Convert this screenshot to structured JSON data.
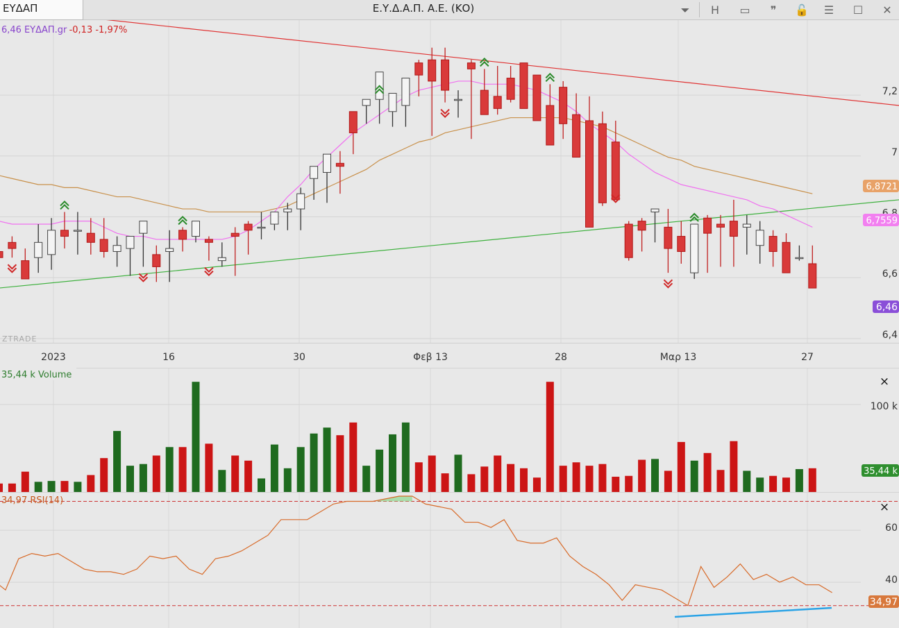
{
  "window": {
    "tab_label": "ΕΥΔΑΠ",
    "title": "Ε.Υ.Δ.Α.Π. Α.Ε. (ΚΟ)",
    "buttons": [
      {
        "name": "dropdown-button",
        "icon": "chevron-down-icon",
        "glyph": "⏷"
      },
      {
        "name": "h-button",
        "icon": "h-letter-icon",
        "glyph": "H"
      },
      {
        "name": "panel-button",
        "icon": "panel-icon",
        "glyph": "▭"
      },
      {
        "name": "quote-button",
        "icon": "quote-icon",
        "glyph": "❞"
      },
      {
        "name": "lock-button",
        "icon": "lock-icon",
        "glyph": "🔓"
      },
      {
        "name": "menu-button",
        "icon": "hamburger-icon",
        "glyph": "☰"
      },
      {
        "name": "maximize-button",
        "icon": "maximize-icon",
        "glyph": "☐"
      },
      {
        "name": "close-button",
        "icon": "close-icon",
        "glyph": "✕"
      }
    ]
  },
  "price_panel": {
    "legend_value": "6,46",
    "legend_name": "ΕΥΔΑΠ.gr",
    "legend_change": "-0,13 -1,97%",
    "watermark": "ZTRADE",
    "y_ticks": [
      "7,2",
      "7",
      "6,8",
      "6,6",
      "6,4"
    ],
    "badges": {
      "ma_slow": "6,8721",
      "ma_fast": "6,7559",
      "last": "6,46"
    }
  },
  "date_axis": [
    "2023",
    "16",
    "30",
    "Φεβ 13",
    "28",
    "Μαρ 13",
    "27"
  ],
  "volume_panel": {
    "legend": "35,44 k Volume",
    "tick": "100 k",
    "badge": "35,44 k",
    "close_glyph": "×"
  },
  "rsi_panel": {
    "legend": "34,97 RSI(14)",
    "ticks": [
      "60",
      "40"
    ],
    "badge": "34,97",
    "close_glyph": "×"
  },
  "colors": {
    "up": "#2a7d2a",
    "down": "#cc1515",
    "candle_down": "#d93a3a",
    "ma_fast": "#f070f0",
    "ma_slow": "#c8904a",
    "rsi": "#d86a28",
    "trend_red": "#e03030",
    "trend_green": "#3cb03c",
    "trend_blue": "#2aa3e6",
    "legend_purple": "#8844cc",
    "badge_last": "#8a4fd8"
  },
  "chart_data": [
    {
      "type": "candlestick",
      "title": "",
      "ylim": [
        6.37,
        7.41
      ],
      "dates": [
        "2022-12-28",
        "2022-12-29",
        "2022-12-30",
        "2023-01-02",
        "2023-01-03",
        "2023-01-04",
        "2023-01-05",
        "2023-01-09",
        "2023-01-10",
        "2023-01-11",
        "2023-01-12",
        "2023-01-13",
        "2023-01-16",
        "2023-01-17",
        "2023-01-18",
        "2023-01-19",
        "2023-01-20",
        "2023-01-23",
        "2023-01-24",
        "2023-01-25",
        "2023-01-26",
        "2023-01-27",
        "2023-01-30",
        "2023-01-31",
        "2023-02-01",
        "2023-02-02",
        "2023-02-03",
        "2023-02-06",
        "2023-02-07",
        "2023-02-08",
        "2023-02-09",
        "2023-02-10",
        "2023-02-13",
        "2023-02-14",
        "2023-02-15",
        "2023-02-16",
        "2023-02-17",
        "2023-02-20",
        "2023-02-21",
        "2023-02-22",
        "2023-02-23",
        "2023-02-24",
        "2023-02-28",
        "2023-03-01",
        "2023-03-02",
        "2023-03-03",
        "2023-03-06",
        "2023-03-07",
        "2023-03-08",
        "2023-03-09",
        "2023-03-10",
        "2023-03-13",
        "2023-03-14",
        "2023-03-15",
        "2023-03-16",
        "2023-03-17",
        "2023-03-20",
        "2023-03-21",
        "2023-03-22",
        "2023-03-23",
        "2023-03-24",
        "2023-03-27",
        "2023-03-28"
      ],
      "open": [
        6.67,
        6.7,
        6.64,
        6.65,
        6.66,
        6.74,
        6.74,
        6.73,
        6.71,
        6.67,
        6.68,
        6.73,
        6.66,
        6.67,
        6.74,
        6.72,
        6.71,
        6.64,
        6.73,
        6.76,
        6.75,
        6.76,
        6.8,
        6.81,
        6.91,
        6.93,
        6.96,
        7.13,
        7.15,
        7.17,
        7.13,
        7.15,
        7.29,
        7.3,
        7.3,
        7.17,
        7.29,
        7.2,
        7.18,
        7.24,
        7.29,
        7.25,
        7.15,
        7.21,
        7.12,
        7.1,
        7.09,
        7.03,
        6.76,
        6.77,
        6.8,
        6.75,
        6.72,
        6.6,
        6.78,
        6.76,
        6.77,
        6.75,
        6.69,
        6.72,
        6.7,
        6.65,
        6.63
      ],
      "high": [
        6.69,
        6.72,
        6.68,
        6.76,
        6.78,
        6.8,
        6.8,
        6.78,
        6.78,
        6.72,
        6.69,
        6.73,
        6.69,
        6.74,
        6.75,
        6.77,
        6.72,
        6.7,
        6.75,
        6.77,
        6.8,
        6.8,
        6.83,
        6.88,
        6.94,
        6.97,
        7.0,
        7.1,
        7.17,
        7.18,
        7.16,
        7.17,
        7.3,
        7.34,
        7.34,
        7.2,
        7.3,
        7.27,
        7.28,
        7.28,
        7.29,
        7.23,
        7.22,
        7.23,
        7.19,
        7.18,
        7.13,
        7.1,
        6.77,
        6.78,
        6.81,
        6.81,
        6.77,
        6.76,
        6.79,
        6.79,
        6.84,
        6.79,
        6.77,
        6.74,
        6.73,
        6.69,
        6.69,
        6.59
      ],
      "low": [
        6.62,
        6.65,
        6.58,
        6.6,
        6.61,
        6.68,
        6.66,
        6.66,
        6.65,
        6.62,
        6.59,
        6.62,
        6.57,
        6.57,
        6.67,
        6.7,
        6.64,
        6.62,
        6.59,
        6.66,
        6.71,
        6.74,
        6.74,
        6.74,
        6.84,
        6.83,
        6.86,
        6.99,
        7.09,
        7.09,
        7.08,
        7.08,
        7.18,
        7.05,
        7.16,
        7.11,
        7.04,
        7.16,
        7.12,
        7.16,
        7.14,
        7.14,
        7.09,
        7.04,
        7.02,
        6.93,
        6.82,
        6.88,
        6.64,
        6.67,
        6.7,
        6.6,
        6.63,
        6.58,
        6.6,
        6.62,
        6.62,
        6.66,
        6.63,
        6.62,
        6.65,
        6.64,
        6.6,
        6.53
      ],
      "close": [
        6.65,
        6.68,
        6.58,
        6.7,
        6.74,
        6.72,
        6.74,
        6.7,
        6.67,
        6.69,
        6.72,
        6.77,
        6.62,
        6.68,
        6.71,
        6.77,
        6.7,
        6.65,
        6.72,
        6.74,
        6.75,
        6.8,
        6.81,
        6.86,
        6.95,
        6.99,
        6.95,
        7.06,
        7.17,
        7.26,
        7.19,
        7.24,
        7.25,
        7.23,
        7.2,
        7.17,
        7.27,
        7.12,
        7.14,
        7.17,
        7.14,
        7.1,
        7.02,
        7.09,
        6.98,
        6.75,
        6.83,
        6.84,
        6.65,
        6.74,
        6.81,
        6.68,
        6.67,
        6.76,
        6.73,
        6.75,
        6.72,
        6.76,
        6.74,
        6.67,
        6.6,
        6.65,
        6.55
      ],
      "ma_slow": {
        "dates": "all",
        "values": [
          6.92,
          6.91,
          6.9,
          6.89,
          6.89,
          6.88,
          6.88,
          6.87,
          6.86,
          6.85,
          6.85,
          6.84,
          6.83,
          6.82,
          6.81,
          6.81,
          6.8,
          6.8,
          6.8,
          6.8,
          6.8,
          6.81,
          6.82,
          6.84,
          6.86,
          6.88,
          6.9,
          6.92,
          6.94,
          6.97,
          6.99,
          7.01,
          7.03,
          7.04,
          7.06,
          7.07,
          7.08,
          7.09,
          7.1,
          7.11,
          7.11,
          7.11,
          7.11,
          7.11,
          7.1,
          7.09,
          7.08,
          7.06,
          7.04,
          7.02,
          7.0,
          6.98,
          6.97,
          6.95,
          6.94,
          6.93,
          6.92,
          6.91,
          6.9,
          6.89,
          6.88,
          6.87,
          6.86
        ]
      },
      "ma_fast": {
        "dates": "all",
        "values": [
          6.77,
          6.76,
          6.76,
          6.76,
          6.76,
          6.77,
          6.77,
          6.77,
          6.75,
          6.73,
          6.72,
          6.72,
          6.71,
          6.71,
          6.71,
          6.71,
          6.71,
          6.71,
          6.72,
          6.74,
          6.77,
          6.8,
          6.85,
          6.89,
          6.94,
          6.98,
          7.02,
          7.06,
          7.09,
          7.12,
          7.15,
          7.18,
          7.2,
          7.21,
          7.22,
          7.23,
          7.23,
          7.22,
          7.22,
          7.22,
          7.21,
          7.2,
          7.18,
          7.16,
          7.13,
          7.09,
          7.06,
          7.03,
          6.99,
          6.96,
          6.93,
          6.91,
          6.89,
          6.88,
          6.87,
          6.86,
          6.85,
          6.84,
          6.82,
          6.81,
          6.79,
          6.77,
          6.75
        ]
      },
      "trendline_resistance": [
        {
          "date": "2022-12-28",
          "price": 7.47
        },
        {
          "date": "2023-03-31",
          "price": 7.15
        }
      ],
      "trendline_support": [
        {
          "date": "2022-12-28",
          "price": 6.55
        },
        {
          "date": "2023-03-31",
          "price": 6.84
        }
      ]
    },
    {
      "type": "bar",
      "title": "Volume",
      "ylim": [
        0,
        140
      ],
      "unit": "k",
      "values": [
        10,
        10,
        24,
        12,
        13,
        13,
        12,
        20,
        40,
        72,
        31,
        33,
        43,
        53,
        53,
        130,
        57,
        26,
        43,
        37,
        16,
        56,
        28,
        53,
        69,
        76,
        67,
        82,
        31,
        50,
        68,
        82,
        35,
        43,
        22,
        44,
        21,
        30,
        43,
        33,
        28,
        17,
        130,
        31,
        35,
        31,
        33,
        18,
        19,
        38,
        39,
        25,
        59,
        37,
        46,
        26,
        60,
        25,
        17,
        19,
        17,
        27,
        28
      ]
    },
    {
      "type": "line",
      "title": "RSI(14)",
      "ylim": [
        27,
        72
      ],
      "reference_lines": [
        30,
        70
      ],
      "values": [
        41,
        40,
        36,
        48,
        50,
        49,
        50,
        47,
        44,
        43,
        43,
        42,
        44,
        49,
        48,
        49,
        44,
        42,
        48,
        49,
        51,
        54,
        57,
        63,
        63,
        63,
        66,
        69,
        70,
        70,
        70,
        71,
        72,
        72,
        69,
        68,
        67,
        62,
        62,
        60,
        63,
        55,
        54,
        54,
        56,
        49,
        45,
        42,
        38,
        32,
        38,
        37,
        36,
        33,
        30,
        45,
        37,
        41,
        46,
        40,
        42,
        39,
        41,
        38,
        38,
        35
      ]
    }
  ]
}
